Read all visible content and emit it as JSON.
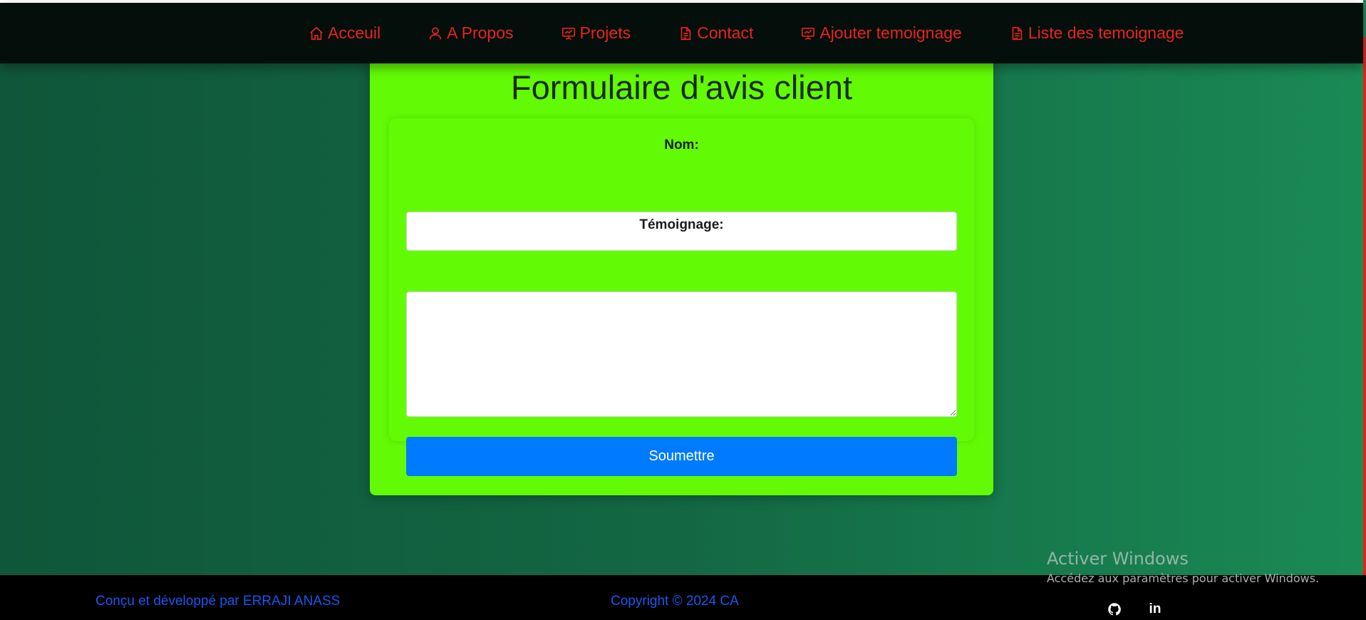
{
  "nav": {
    "items": [
      {
        "label": "Acceuil",
        "icon": "home-icon"
      },
      {
        "label": "A Propos",
        "icon": "user-icon"
      },
      {
        "label": "Projets",
        "icon": "presentation-icon"
      },
      {
        "label": "Contact",
        "icon": "document-icon"
      },
      {
        "label": "Ajouter temoignage",
        "icon": "presentation-icon"
      },
      {
        "label": "Liste des temoignage",
        "icon": "document-icon"
      }
    ],
    "color": "#e8231e"
  },
  "form": {
    "title": "Formulaire d'avis client",
    "name_label": "Nom:",
    "name_value": "",
    "testimony_label": "Témoignage:",
    "testimony_value": "",
    "submit_label": "Soumettre"
  },
  "watermark": {
    "title": "Activer Windows",
    "subtitle": "Accédez aux paramètres pour activer Windows."
  },
  "footer": {
    "credit": "Conçu et développé par ERRAJI ANASS",
    "copyright": "Copyright © 2024 CA",
    "social": [
      {
        "icon": "github-icon"
      },
      {
        "icon": "linkedin-icon",
        "text": "in"
      }
    ]
  },
  "colors": {
    "card": "#62fb05",
    "button": "#007bff",
    "footer_text": "#1b56f1",
    "nav_bg": "#040e0a"
  }
}
